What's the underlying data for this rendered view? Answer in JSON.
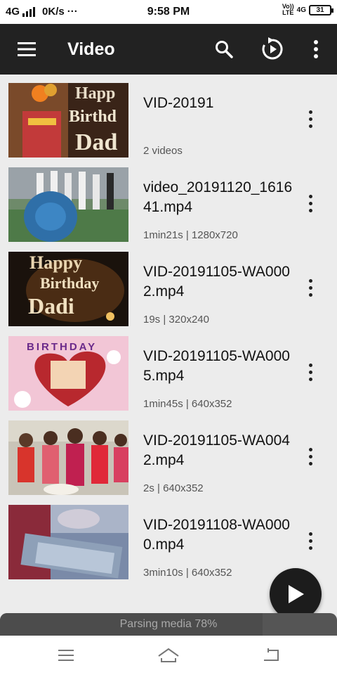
{
  "status_bar": {
    "network": "4G",
    "speed": "0K/s",
    "dots": "···",
    "time": "9:58 PM",
    "volte_top": "Vo))",
    "volte_bottom": "LTE",
    "lte_4g": "4G",
    "battery": "31"
  },
  "app_bar": {
    "title": "Video",
    "icons": [
      "menu-icon",
      "search-icon",
      "refresh-icon",
      "more-vert-icon"
    ]
  },
  "videos": [
    {
      "name": "VID-20191",
      "meta": "2 videos"
    },
    {
      "name": "video_20191120_161641.mp4",
      "meta": "1min21s  |  1280x720"
    },
    {
      "name": "VID-20191105-WA0002.mp4",
      "meta": "19s  |  320x240"
    },
    {
      "name": "VID-20191105-WA0005.mp4",
      "meta": "1min45s  |  640x352"
    },
    {
      "name": "VID-20191105-WA0042.mp4",
      "meta": "2s  |  640x352"
    },
    {
      "name": "VID-20191108-WA0000.mp4",
      "meta": "3min10s  |  640x352"
    }
  ],
  "thumbnail_texts": {
    "t1": "Happy Birthday Dad",
    "t3": "Happy Birthday Dadi",
    "t4": "BIRTHDAY"
  },
  "parsing": {
    "text": "Parsing media 78%",
    "progress": 0.78
  },
  "colors": {
    "app_bar": "#222222",
    "background": "#ececec",
    "fab": "#1c1c1c"
  },
  "nav_bar": {
    "icons": [
      "recents-icon",
      "home-icon",
      "back-icon"
    ]
  },
  "fab": {
    "icon": "play-icon"
  }
}
